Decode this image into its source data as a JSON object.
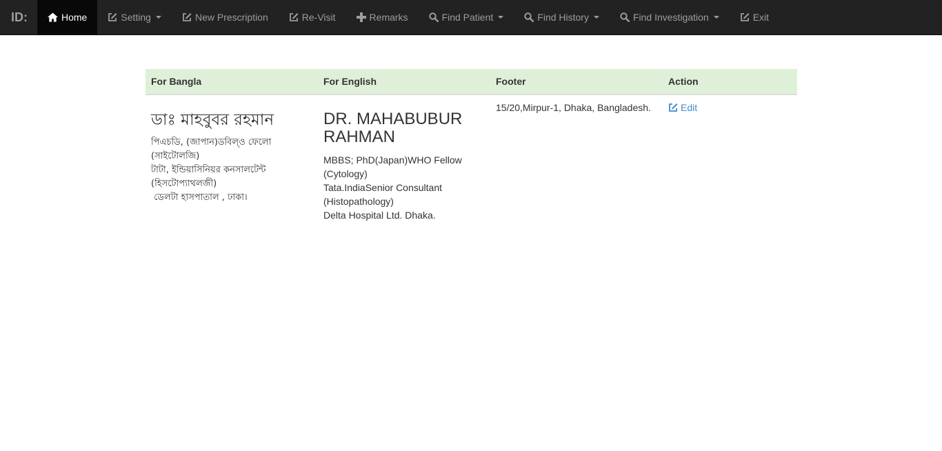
{
  "navbar": {
    "brand": "ID:",
    "items": [
      {
        "label": "Home",
        "icon": "home-icon",
        "dropdown": false
      },
      {
        "label": "Setting",
        "icon": "edit-icon",
        "dropdown": true
      },
      {
        "label": "New Prescription",
        "icon": "edit-icon",
        "dropdown": false
      },
      {
        "label": "Re-Visit",
        "icon": "edit-icon",
        "dropdown": false
      },
      {
        "label": "Remarks",
        "icon": "plus-icon",
        "dropdown": false
      },
      {
        "label": "Find Patient",
        "icon": "search-icon",
        "dropdown": true
      },
      {
        "label": "Find History",
        "icon": "search-icon",
        "dropdown": true
      },
      {
        "label": "Find Investigation",
        "icon": "search-icon",
        "dropdown": true
      },
      {
        "label": "Exit",
        "icon": "edit-icon",
        "dropdown": false
      }
    ]
  },
  "table": {
    "headers": [
      "For Bangla",
      "For English",
      "Footer",
      "Action"
    ],
    "row": {
      "bangla": {
        "name": "ডাঃ মাহবুবর রহমান",
        "lines": [
          "পিএচডি, (জাপান)ডবিল্ও ফেলো (সাইটোলজি)",
          "টাটা, ইন্ডিয়াসিনিয়র কনসালটেন্ট",
          "(হিসটোপ্যাথলজী)",
          " ডেলটা হাসপাতাল , ঢাকা।"
        ]
      },
      "english": {
        "name": "DR. MAHABUBUR RAHMAN",
        "lines": [
          "MBBS; PhD(Japan)WHO Fellow (Cytology)",
          "Tata.IndiaSenior Consultant (Histopathology)",
          "Delta Hospital Ltd. Dhaka."
        ]
      },
      "footer": "15/20,Mirpur-1, Dhaka, Bangladesh.",
      "action_label": "Edit"
    }
  },
  "colors": {
    "navbar_bg": "#222222",
    "navbar_text": "#9d9d9d",
    "active_bg": "#080808",
    "header_bg": "#dff0d8",
    "link": "#428bca"
  }
}
